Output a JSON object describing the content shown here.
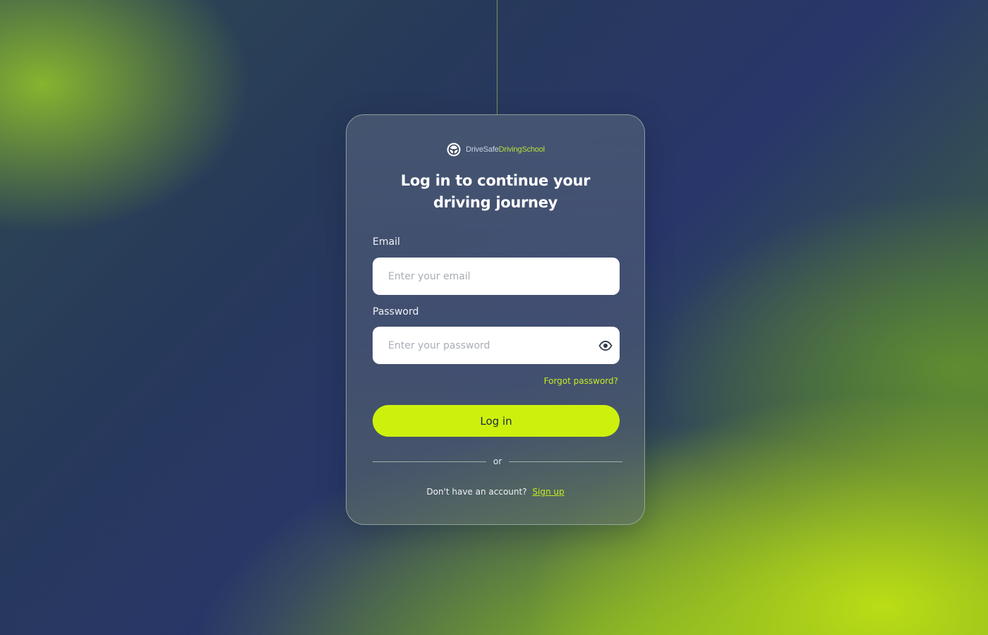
{
  "brand": {
    "name_part1": "DriveSafe",
    "name_part2": "DrivingSchool"
  },
  "title": {
    "line1": "Log in to continue your",
    "line2": "driving journey"
  },
  "form": {
    "email_label": "Email",
    "email_placeholder": "Enter your email",
    "email_value": "",
    "password_label": "Password",
    "password_placeholder": "Enter your password",
    "password_value": "",
    "forgot_link": "Forgot password?",
    "login_button": "Log in",
    "divider_text": "or",
    "signup_prompt": "Don't have an account?",
    "signup_link": "Sign up"
  },
  "icons": {
    "brand": "steering-wheel-icon",
    "password_toggle": "eye-icon"
  },
  "colors": {
    "accent": "#cdf10d",
    "link": "#c6ec23",
    "title": "#ffffff",
    "card_border": "#c8d7be"
  }
}
